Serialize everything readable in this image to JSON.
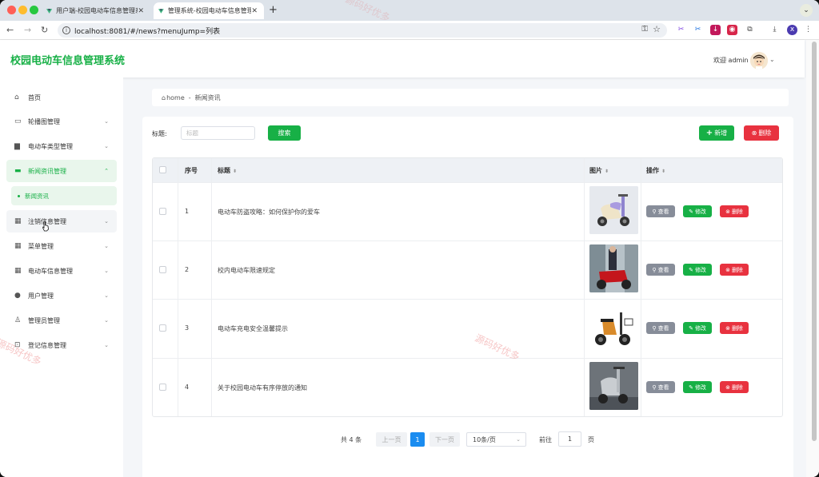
{
  "browser": {
    "tabs": [
      {
        "title": "用户端-校园电动车信息管理系统"
      },
      {
        "title": "管理系统-校园电动车信息管理系统"
      }
    ],
    "url": "localhost:8081/#/news?menuJump=列表"
  },
  "header": {
    "title": "校园电动车信息管理系统",
    "welcome": "欢迎 admin"
  },
  "sidebar": {
    "items": [
      {
        "label": "首页"
      },
      {
        "label": "轮播图管理"
      },
      {
        "label": "电动车类型管理"
      },
      {
        "label": "新闻资讯管理"
      },
      {
        "label": "注销信息管理"
      },
      {
        "label": "菜单管理"
      },
      {
        "label": "电动车信息管理"
      },
      {
        "label": "用户管理"
      },
      {
        "label": "管理员管理"
      },
      {
        "label": "登记信息管理"
      }
    ],
    "submenu_label": "新闻资讯"
  },
  "breadcrumb": {
    "home": "home",
    "sep": "-",
    "current": "新闻资讯"
  },
  "search": {
    "label": "标题:",
    "placeholder": "标题",
    "button": "搜索"
  },
  "actions": {
    "add": "新增",
    "delete": "删除"
  },
  "table": {
    "headers": {
      "index": "序号",
      "title": "标题",
      "image": "图片",
      "ops": "操作"
    },
    "rows": [
      {
        "index": "1",
        "title": "电动车防盗攻略：如何保护你的爱车"
      },
      {
        "index": "2",
        "title": "校内电动车限速规定"
      },
      {
        "index": "3",
        "title": "电动车充电安全温馨提示"
      },
      {
        "index": "4",
        "title": "关于校园电动车有序停放的通知"
      }
    ],
    "row_actions": {
      "view": "查看",
      "edit": "修改",
      "delete": "删除"
    }
  },
  "pagination": {
    "total": "共 4 条",
    "prev": "上一页",
    "current": "1",
    "next": "下一页",
    "page_size": "10条/页",
    "goto_label": "前往",
    "goto_value": "1",
    "goto_unit": "页"
  },
  "watermark": "源码好优多",
  "colors": {
    "accent": "#17b046",
    "danger": "#e8323f",
    "pager": "#1a8cf0"
  }
}
